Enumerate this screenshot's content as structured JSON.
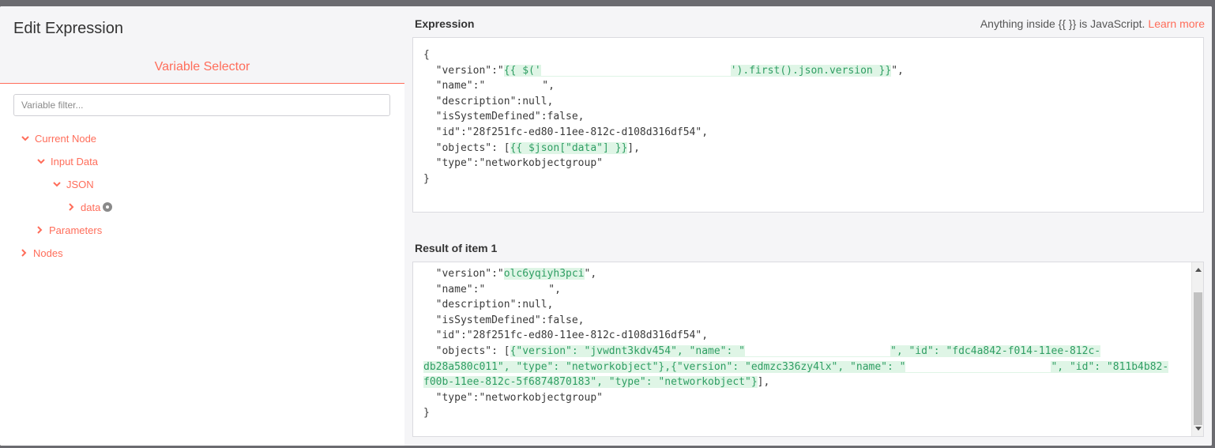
{
  "dialog": {
    "title": "Edit Expression"
  },
  "variable_selector": {
    "tab_label": "Variable Selector",
    "filter_placeholder": "Variable filter...",
    "tree": [
      {
        "label": "Current Node",
        "expanded": true
      },
      {
        "label": "Input Data",
        "expanded": true
      },
      {
        "label": "JSON",
        "expanded": true
      },
      {
        "label": "data",
        "expanded": false
      },
      {
        "label": "Parameters",
        "expanded": false
      },
      {
        "label": "Nodes",
        "expanded": false
      }
    ]
  },
  "expression": {
    "label": "Expression",
    "hint_text": "Anything inside {{ }} is JavaScript.",
    "learn_more": "Learn more",
    "lines": {
      "l1": "{",
      "l2a": "  \"version\":\"",
      "l2b": "{{ $('",
      "l2c": "').first().json.version }}",
      "l2d": "\",",
      "l3a": "  \"name\":\"",
      "l3b": "\",",
      "l4": "  \"description\":null,",
      "l5": "  \"isSystemDefined\":false,",
      "l6": "  \"id\":\"28f251fc-ed80-11ee-812c-d108d316df54\",",
      "l7a": "  \"objects\": [",
      "l7b": "{{ $json[\"data\"] }}",
      "l7c": "],",
      "l8": "  \"type\":\"networkobjectgroup\"",
      "l9": "}"
    }
  },
  "result": {
    "label": "Result of item 1",
    "lines": {
      "r2a": "  \"version\":\"",
      "r2b": "olc6yqiyh3pci",
      "r2c": "\",",
      "r3a": "  \"name\":\"",
      "r3b": "\",",
      "r4": "  \"description\":null,",
      "r5": "  \"isSystemDefined\":false,",
      "r6": "  \"id\":\"28f251fc-ed80-11ee-812c-d108d316df54\",",
      "r7a": "  \"objects\": [",
      "r7b": "{\"version\": \"jvwdnt3kdv454\", \"name\": \"",
      "r7c": "\", \"id\": \"fdc4a842-f014-11ee-812c-",
      "r8a": "db28a580c011\", \"type\": \"networkobject\"},{\"version\": \"edmzc336zy4lx\", \"name\": \"",
      "r8b": "\", \"id\": \"811b4b82-",
      "r9a": "f00b-11ee-812c-5f6874870183\", \"type\": \"networkobject\"}",
      "r9b": "],",
      "r10": "  \"type\":\"networkobjectgroup\"",
      "r11": "}"
    }
  },
  "colors": {
    "accent": "#ff6d5a",
    "highlight_bg": "#dff5e6",
    "highlight_text": "#2f9e63"
  }
}
